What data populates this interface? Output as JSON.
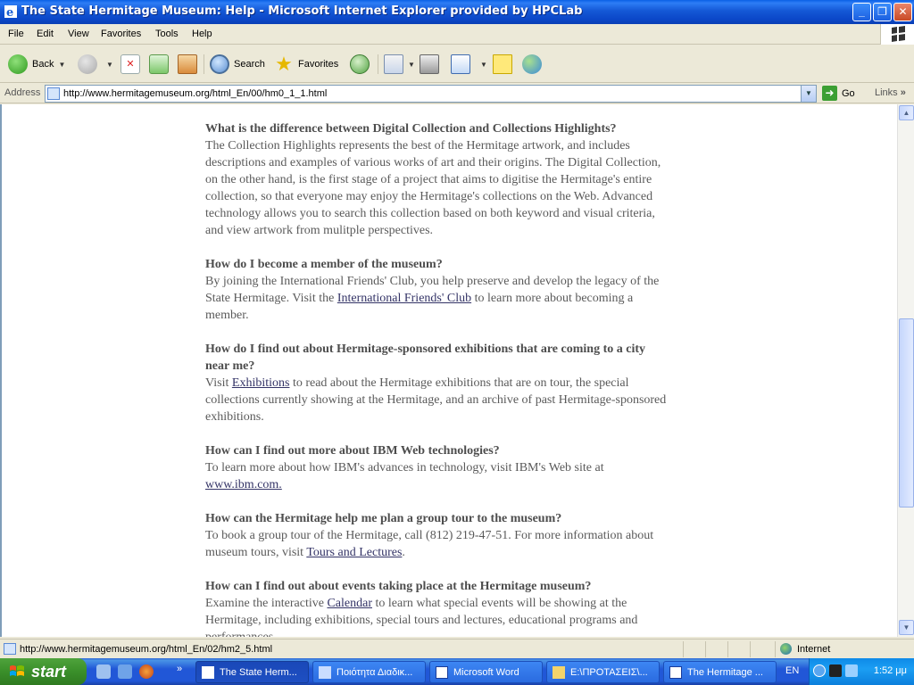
{
  "window": {
    "title": "The State Hermitage Museum: Help - Microsoft Internet Explorer provided by HPCLab"
  },
  "menu": [
    "File",
    "Edit",
    "View",
    "Favorites",
    "Tools",
    "Help"
  ],
  "toolbar": {
    "back_label": "Back",
    "search_label": "Search",
    "favorites_label": "Favorites"
  },
  "address": {
    "label": "Address",
    "url": "http://www.hermitagemuseum.org/html_En/00/hm0_1_1.html",
    "go_label": "Go",
    "links_label": "Links"
  },
  "content": {
    "qa": [
      {
        "q": "What is the difference between Digital Collection and Collections Highlights?",
        "a": "The Collection Highlights represents the best of the Hermitage artwork, and includes descriptions and examples of various works of art and their origins. The Digital Collection, on the other hand, is the first stage of a project that aims to digitise the Hermitage's entire collection, so that everyone may enjoy the Hermitage's collections on the Web. Advanced technology allows you to search this collection based on both keyword and visual criteria, and view artwork from mulitple perspectives."
      },
      {
        "q": "How do I become a member of the museum?",
        "a_before": "By joining the International Friends' Club, you help preserve and develop the legacy of the State Hermitage. Visit the ",
        "link": "International Friends' Club",
        "a_after": " to learn more about becoming a member."
      },
      {
        "q": "How do I find out about Hermitage-sponsored exhibitions that are coming to a city near me?",
        "a_before": "Visit ",
        "link": "Exhibitions",
        "a_after": " to read about the Hermitage exhibitions that are on tour, the special collections currently showing at the Hermitage, and an archive of past Hermitage-sponsored exhibitions."
      },
      {
        "q": "How can I find out more about IBM Web technologies?",
        "a_before": "To learn more about how IBM's advances in technology, visit IBM's Web site at ",
        "link": "www.ibm.com.",
        "a_after": ""
      },
      {
        "q": "How can the Hermitage help me plan a group tour to the museum?",
        "a_before": "To book a group tour of the Hermitage, call (812) 219-47-51. For more information about museum tours, visit ",
        "link": "Tours and Lectures",
        "a_after": "."
      },
      {
        "q": "How can I find out about events taking place at the Hermitage museum?",
        "a_before": "Examine the interactive ",
        "link": "Calendar",
        "a_after": " to learn what special events will be showing at the Hermitage, including exhibitions, special tours and lectures, educational programs and performances."
      }
    ]
  },
  "status": {
    "text": "http://www.hermitagemuseum.org/html_En/02/hm2_5.html",
    "zone": "Internet"
  },
  "taskbar": {
    "start_label": "start",
    "tasks": [
      "The State Herm...",
      "Ποιότητα Διαδικ...",
      "Microsoft Word",
      "E:\\ΠΡΟΤΑΣΕΙΣ\\...",
      "The Hermitage ..."
    ],
    "language": "EN",
    "clock": "1:52 μμ"
  },
  "colors": {
    "titlebar": "#0b47c8",
    "taskbar": "#2157d7",
    "start": "#3a8f2a",
    "body_text": "#5a5a5a",
    "link": "#333366"
  }
}
